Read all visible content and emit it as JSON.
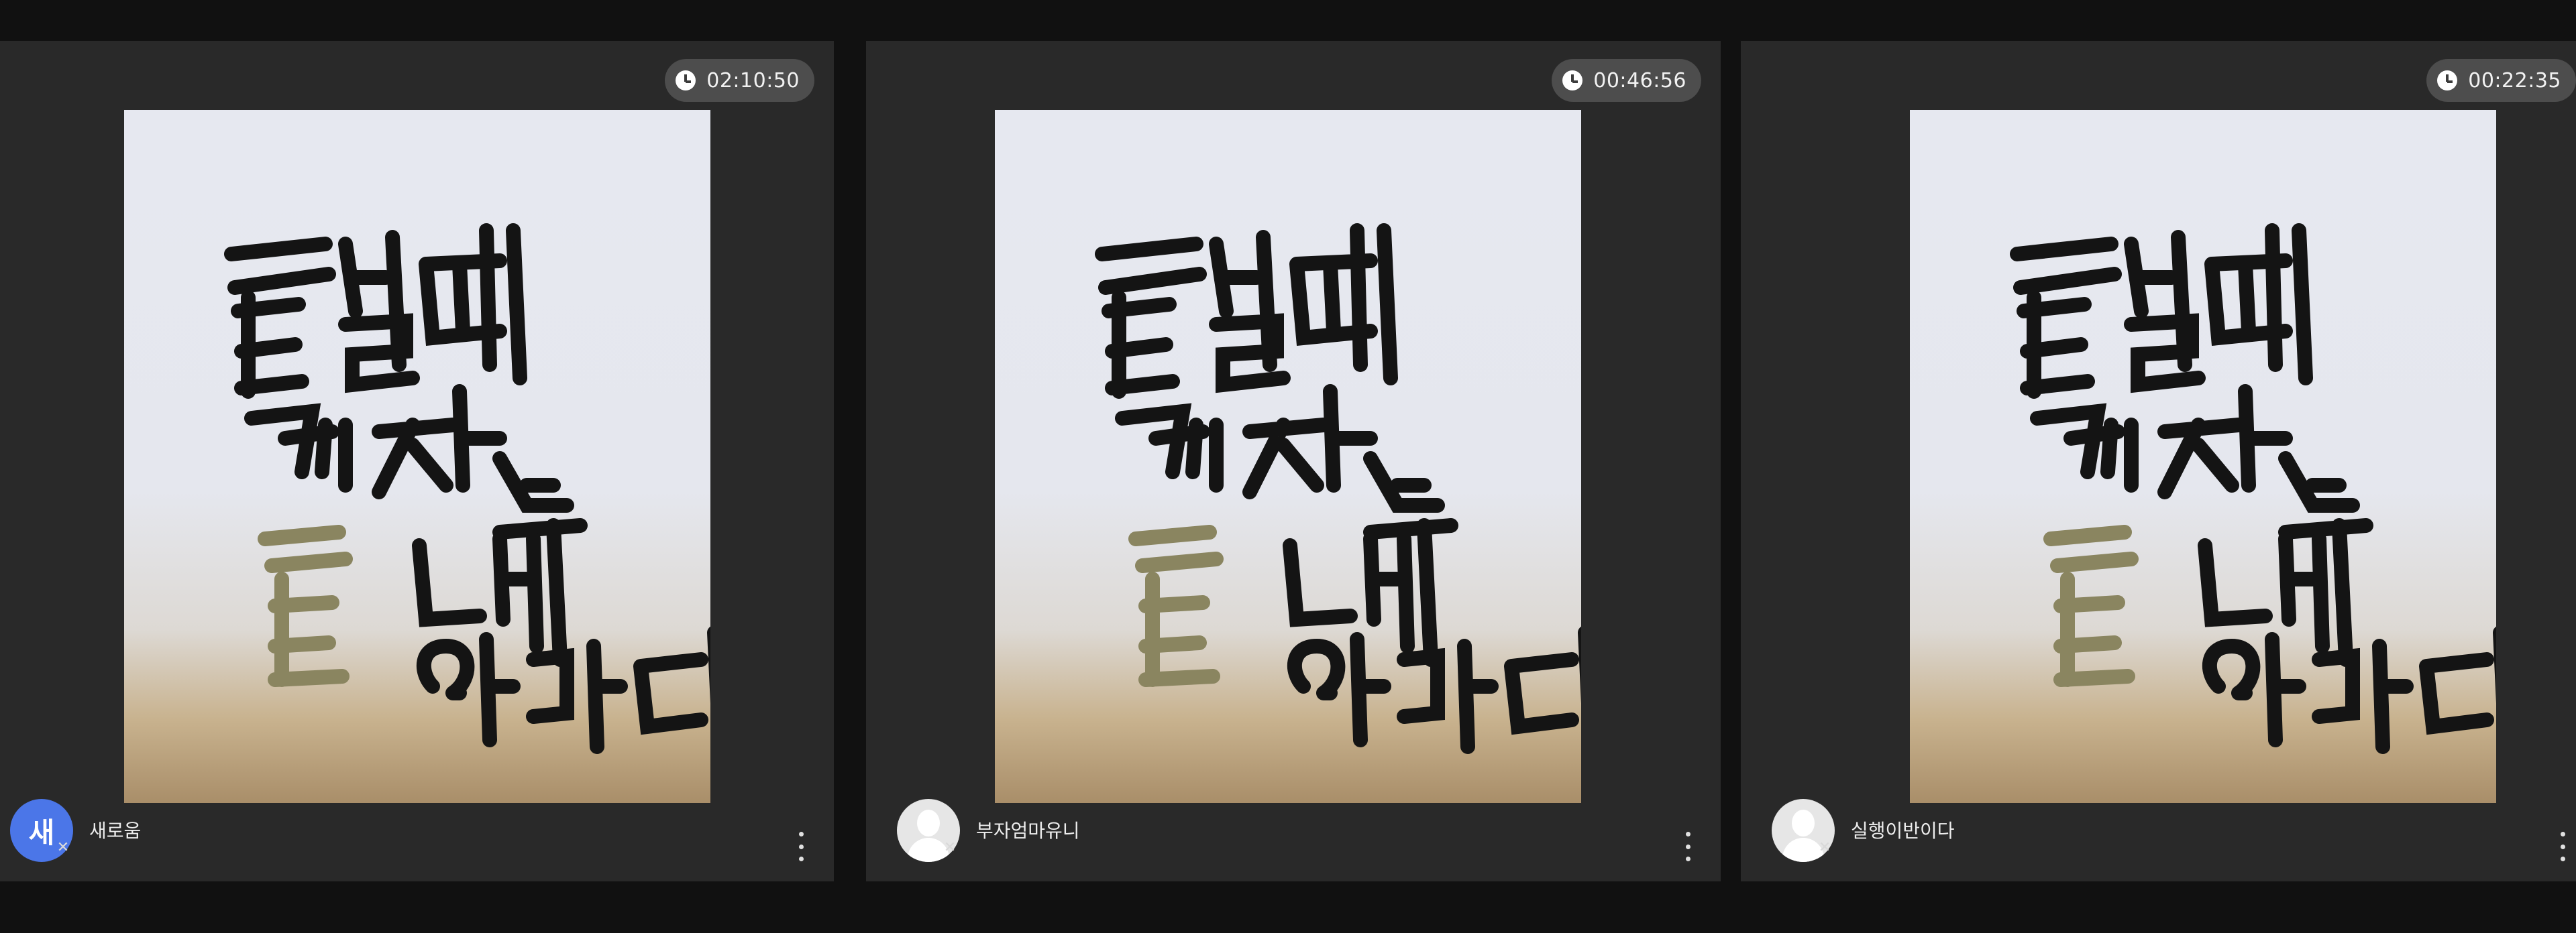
{
  "tiles": [
    {
      "timer": "02:10:50",
      "avatar_letter": "새",
      "avatar_type": "letter",
      "name": "새로움"
    },
    {
      "timer": "00:46:56",
      "avatar_letter": "",
      "avatar_type": "person",
      "name": "부자엄마유니"
    },
    {
      "timer": "00:22:35",
      "avatar_letter": "",
      "avatar_type": "person",
      "name": "실행이반이다"
    }
  ],
  "video_caption": "끝날때까지는 끝난게 아니다",
  "icons": [
    "clock-icon",
    "mic-off-icon",
    "more-options-icon",
    "default-avatar-icon"
  ],
  "colors": {
    "background": "#111111",
    "tile": "#292929",
    "timer_pill": "#4d4d4d",
    "avatar_accent": "#4b76e8"
  }
}
